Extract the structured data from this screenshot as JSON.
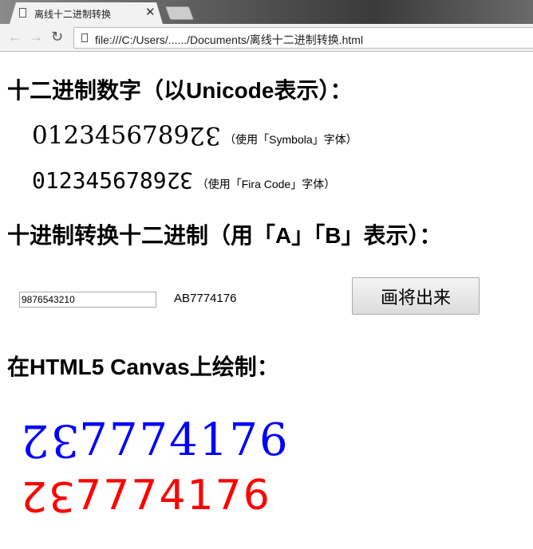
{
  "browser": {
    "tab_title": "离线十二进制转换",
    "url": "file:///C:/Users/....../Documents/离线十二进制转换.html"
  },
  "section1": {
    "heading": "十二进制数字（以Unicode表示）：",
    "digits": "0123456789",
    "turned_two": "2",
    "turned_three": "3",
    "symbola_note": "（使用「Symbola」字体）",
    "fira_note": "（使用「Fira Code」字体）"
  },
  "section2": {
    "heading": "十进制转换十二进制（用「A」「B」表示）：",
    "input_value": "9876543210",
    "output": "AB7774176",
    "button_label": "画将出来"
  },
  "section3": {
    "heading": "在HTML5 Canvas上绘制：",
    "turned_two": "2",
    "turned_three": "3",
    "rest": "7774176",
    "colors": {
      "serif_line": "#0000ff",
      "sans_line": "#ff0000"
    }
  }
}
